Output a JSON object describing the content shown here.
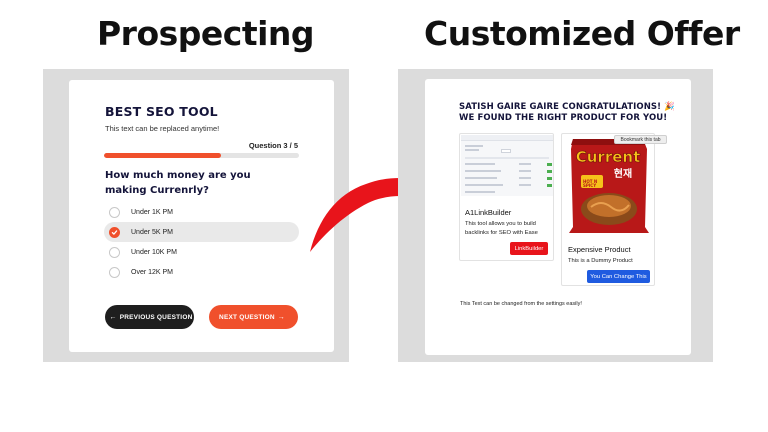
{
  "headings": {
    "left": "Prospecting",
    "right": "Customized Offer"
  },
  "quiz": {
    "title": "BEST SEO TOOL",
    "subtitle": "This text can be replaced anytime!",
    "question_counter": "Question 3 / 5",
    "progress": 0.6,
    "question": "How much money are you making Currenrly?",
    "options": [
      {
        "label": "Under 1K PM",
        "selected": false
      },
      {
        "label": "Under 5K PM",
        "selected": true
      },
      {
        "label": "Under 10K PM",
        "selected": false
      },
      {
        "label": "Over 12K PM",
        "selected": false
      }
    ],
    "prev_button": "PREVIOUS QUESTION",
    "next_button": "NEXT QUESTION",
    "accent_color": "#f0502c"
  },
  "offer": {
    "title_line1": "SATISH GAIRE GAIRE CONGRATULATIONS!",
    "title_emoji": "🎉",
    "title_line2": "WE FOUND THE RIGHT PRODUCT FOR YOU!",
    "products": [
      {
        "name": "A1LinkBuilder",
        "description": "This tool allows you to build backlinks for SEO with Ease",
        "button": "LinkBuilder",
        "button_color": "#e8141b"
      },
      {
        "name": "Expensive Product",
        "description": "This is a Dummy Product",
        "button": "You Can Change This",
        "button_color": "#1f5be0",
        "tooltip": "Bookmark this tab",
        "package_brand": "Current",
        "package_korean": "현재"
      }
    ],
    "footnote": "This Text can be changed from the settings easily!"
  }
}
